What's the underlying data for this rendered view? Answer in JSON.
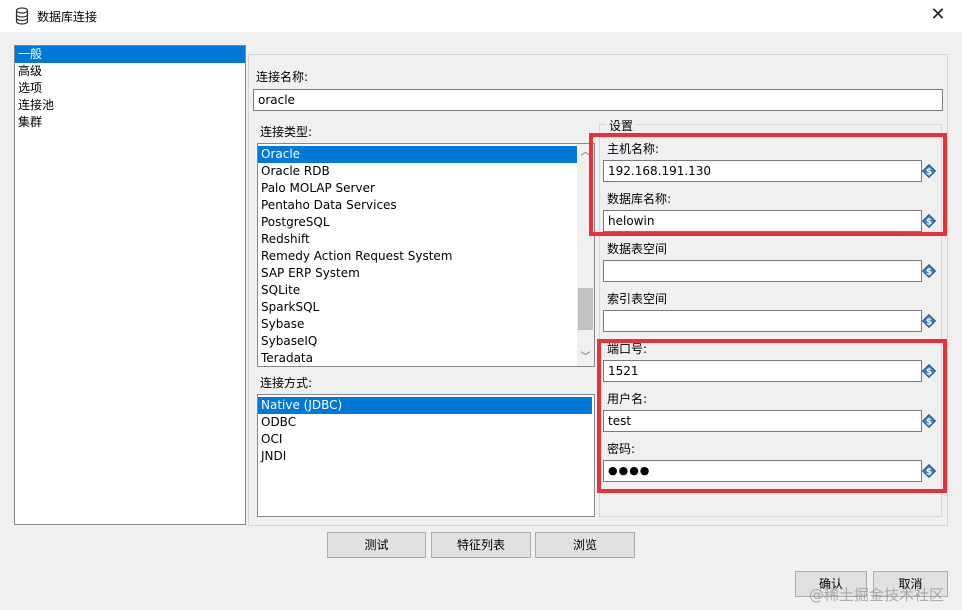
{
  "window": {
    "title": "数据库连接",
    "close_glyph": "✕"
  },
  "nav": {
    "items": [
      {
        "label": "一般",
        "selected": true
      },
      {
        "label": "高级",
        "selected": false
      },
      {
        "label": "选项",
        "selected": false
      },
      {
        "label": "连接池",
        "selected": false
      },
      {
        "label": "集群",
        "selected": false
      }
    ]
  },
  "connection_name": {
    "label": "连接名称:",
    "value": "oracle"
  },
  "connection_type": {
    "label": "连接类型:",
    "items": [
      {
        "label": "Oracle",
        "selected": true
      },
      {
        "label": "Oracle RDB",
        "selected": false
      },
      {
        "label": "Palo MOLAP Server",
        "selected": false
      },
      {
        "label": "Pentaho Data Services",
        "selected": false
      },
      {
        "label": "PostgreSQL",
        "selected": false
      },
      {
        "label": "Redshift",
        "selected": false
      },
      {
        "label": "Remedy Action Request System",
        "selected": false
      },
      {
        "label": "SAP ERP System",
        "selected": false
      },
      {
        "label": "SQLite",
        "selected": false
      },
      {
        "label": "SparkSQL",
        "selected": false
      },
      {
        "label": "Sybase",
        "selected": false
      },
      {
        "label": "SybaseIQ",
        "selected": false
      },
      {
        "label": "Teradata",
        "selected": false
      }
    ]
  },
  "access": {
    "label": "连接方式:",
    "items": [
      {
        "label": "Native (JDBC)",
        "selected": true
      },
      {
        "label": "ODBC",
        "selected": false
      },
      {
        "label": "OCI",
        "selected": false
      },
      {
        "label": "JNDI",
        "selected": false
      }
    ]
  },
  "settings": {
    "title": "设置",
    "host": {
      "label": "主机名称:",
      "value": "192.168.191.130"
    },
    "dbname": {
      "label": "数据库名称:",
      "value": "helowin"
    },
    "tablespace": {
      "label": "数据表空间",
      "value": ""
    },
    "indexspace": {
      "label": "索引表空间",
      "value": ""
    },
    "port": {
      "label": "端口号:",
      "value": "1521"
    },
    "username": {
      "label": "用户名:",
      "value": "test"
    },
    "password": {
      "label": "密码:",
      "value": "●●●●"
    }
  },
  "buttons": {
    "test": "测试",
    "features": "特征列表",
    "explore": "浏览",
    "ok": "确认",
    "cancel": "取消"
  },
  "watermark": "@稀土掘金技术社区",
  "colors": {
    "selection": "#0078d7",
    "highlight_box": "#e8303a"
  }
}
